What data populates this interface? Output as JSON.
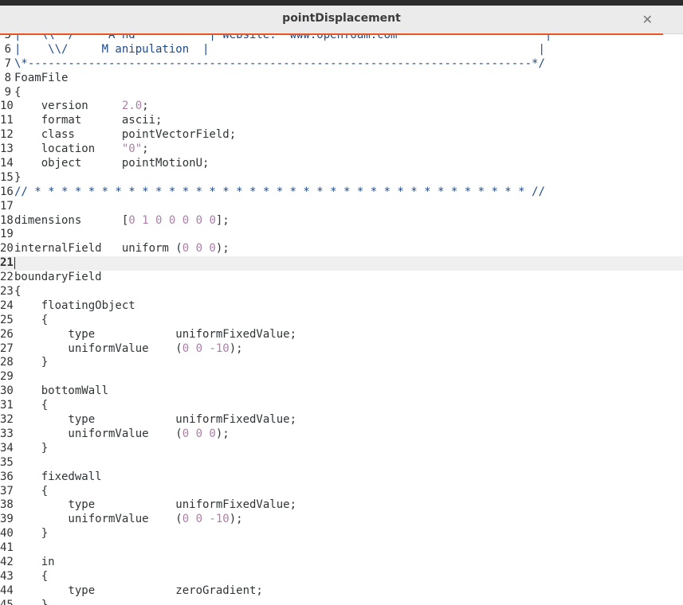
{
  "window": {
    "title": "pointDisplacement"
  },
  "accent_color": "#e95420",
  "editor": {
    "current_line": "21",
    "lines": [
      {
        "n": "5",
        "segs": [
          {
            "t": "|   \\\\  /     A nd           | Website:  www.openfoam.com                      |",
            "k": "c"
          }
        ]
      },
      {
        "n": "6",
        "segs": [
          {
            "t": "|    \\\\/     M anipulation  |                                                 |",
            "k": "c"
          }
        ]
      },
      {
        "n": "7",
        "segs": [
          {
            "t": "\\*---------------------------------------------------------------------------*/",
            "k": "c"
          }
        ]
      },
      {
        "n": "8",
        "segs": [
          {
            "t": "FoamFile",
            "k": ""
          }
        ]
      },
      {
        "n": "9",
        "segs": [
          {
            "t": "{",
            "k": ""
          }
        ]
      },
      {
        "n": "10",
        "segs": [
          {
            "t": "    version     ",
            "k": ""
          },
          {
            "t": "2.0",
            "k": "n"
          },
          {
            "t": ";",
            "k": ""
          }
        ]
      },
      {
        "n": "11",
        "segs": [
          {
            "t": "    format      ascii;",
            "k": ""
          }
        ]
      },
      {
        "n": "12",
        "segs": [
          {
            "t": "    class       pointVectorField;",
            "k": ""
          }
        ]
      },
      {
        "n": "13",
        "segs": [
          {
            "t": "    location    ",
            "k": ""
          },
          {
            "t": "\"0\"",
            "k": "n"
          },
          {
            "t": ";",
            "k": ""
          }
        ]
      },
      {
        "n": "14",
        "segs": [
          {
            "t": "    object      pointMotionU;",
            "k": ""
          }
        ]
      },
      {
        "n": "15",
        "segs": [
          {
            "t": "}",
            "k": ""
          }
        ]
      },
      {
        "n": "16",
        "segs": [
          {
            "t": "// * * * * * * * * * * * * * * * * * * * * * * * * * * * * * * * * * * * * * //",
            "k": "c"
          }
        ]
      },
      {
        "n": "17",
        "segs": []
      },
      {
        "n": "18",
        "segs": [
          {
            "t": "dimensions      [",
            "k": ""
          },
          {
            "t": "0 1 0 0 0 0 0",
            "k": "n"
          },
          {
            "t": "];",
            "k": ""
          }
        ]
      },
      {
        "n": "19",
        "segs": []
      },
      {
        "n": "20",
        "segs": [
          {
            "t": "internalField   uniform (",
            "k": ""
          },
          {
            "t": "0 0 0",
            "k": "n"
          },
          {
            "t": ");",
            "k": ""
          }
        ]
      },
      {
        "n": "21",
        "segs": []
      },
      {
        "n": "22",
        "segs": [
          {
            "t": "boundaryField",
            "k": ""
          }
        ]
      },
      {
        "n": "23",
        "segs": [
          {
            "t": "{",
            "k": ""
          }
        ]
      },
      {
        "n": "24",
        "segs": [
          {
            "t": "    floatingObject",
            "k": ""
          }
        ]
      },
      {
        "n": "25",
        "segs": [
          {
            "t": "    {",
            "k": ""
          }
        ]
      },
      {
        "n": "26",
        "segs": [
          {
            "t": "        type            uniformFixedValue;",
            "k": ""
          }
        ]
      },
      {
        "n": "27",
        "segs": [
          {
            "t": "        uniformValue    (",
            "k": ""
          },
          {
            "t": "0 0 -10",
            "k": "n"
          },
          {
            "t": ");",
            "k": ""
          }
        ]
      },
      {
        "n": "28",
        "segs": [
          {
            "t": "    }",
            "k": ""
          }
        ]
      },
      {
        "n": "29",
        "segs": []
      },
      {
        "n": "30",
        "segs": [
          {
            "t": "    bottomWall",
            "k": ""
          }
        ]
      },
      {
        "n": "31",
        "segs": [
          {
            "t": "    {",
            "k": ""
          }
        ]
      },
      {
        "n": "32",
        "segs": [
          {
            "t": "        type            uniformFixedValue;",
            "k": ""
          }
        ]
      },
      {
        "n": "33",
        "segs": [
          {
            "t": "        uniformValue    (",
            "k": ""
          },
          {
            "t": "0 0 0",
            "k": "n"
          },
          {
            "t": ");",
            "k": ""
          }
        ]
      },
      {
        "n": "34",
        "segs": [
          {
            "t": "    }",
            "k": ""
          }
        ]
      },
      {
        "n": "35",
        "segs": []
      },
      {
        "n": "36",
        "segs": [
          {
            "t": "    fixedwall",
            "k": ""
          }
        ]
      },
      {
        "n": "37",
        "segs": [
          {
            "t": "    {",
            "k": ""
          }
        ]
      },
      {
        "n": "38",
        "segs": [
          {
            "t": "        type            uniformFixedValue;",
            "k": ""
          }
        ]
      },
      {
        "n": "39",
        "segs": [
          {
            "t": "        uniformValue    (",
            "k": ""
          },
          {
            "t": "0 0 -10",
            "k": "n"
          },
          {
            "t": ");",
            "k": ""
          }
        ]
      },
      {
        "n": "40",
        "segs": [
          {
            "t": "    }",
            "k": ""
          }
        ]
      },
      {
        "n": "41",
        "segs": []
      },
      {
        "n": "42",
        "segs": [
          {
            "t": "    in",
            "k": ""
          }
        ]
      },
      {
        "n": "43",
        "segs": [
          {
            "t": "    {",
            "k": ""
          }
        ]
      },
      {
        "n": "44",
        "segs": [
          {
            "t": "        type            zeroGradient;",
            "k": ""
          }
        ]
      },
      {
        "n": "45",
        "segs": [
          {
            "t": "    }",
            "k": ""
          }
        ]
      }
    ]
  }
}
